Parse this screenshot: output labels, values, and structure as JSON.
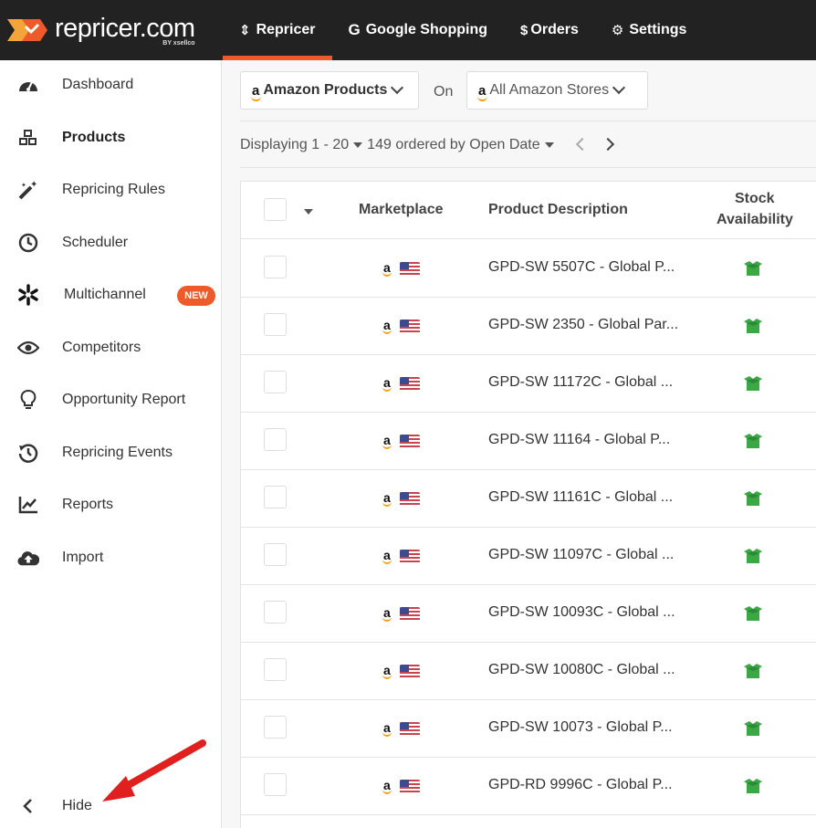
{
  "header": {
    "logo_text": "repricer.com",
    "logo_by": "BY xsellco",
    "nav": [
      {
        "label": "Repricer",
        "icon": "sort-icon",
        "active": true
      },
      {
        "label": "Google Shopping",
        "icon": "google-icon",
        "active": false
      },
      {
        "label": "Orders",
        "icon": "dollar-icon",
        "active": false
      },
      {
        "label": "Settings",
        "icon": "gear-icon",
        "active": false
      }
    ]
  },
  "sidebar": {
    "items": [
      {
        "label": "Dashboard",
        "icon": "dashboard-gauge-icon"
      },
      {
        "label": "Products",
        "icon": "cubes-icon"
      },
      {
        "label": "Repricing Rules",
        "icon": "magic-wand-icon"
      },
      {
        "label": "Scheduler",
        "icon": "clock-icon"
      },
      {
        "label": "Multichannel",
        "icon": "asterisk-icon",
        "badge": "NEW"
      },
      {
        "label": "Competitors",
        "icon": "eye-icon"
      },
      {
        "label": "Opportunity Report",
        "icon": "lightbulb-icon"
      },
      {
        "label": "Repricing Events",
        "icon": "history-icon"
      },
      {
        "label": "Reports",
        "icon": "line-chart-icon"
      },
      {
        "label": "Import",
        "icon": "cloud-upload-icon"
      }
    ],
    "hide_label": "Hide"
  },
  "filters": {
    "products_label": "Amazon Products",
    "on_label": "On",
    "stores_label": "All Amazon Stores"
  },
  "pagination": {
    "range": "Displaying 1 - 20",
    "total_text": "149 ordered by Open Date"
  },
  "table": {
    "headers": {
      "marketplace": "Marketplace",
      "description": "Product Description",
      "stock_line1": "Stock",
      "stock_line2": "Availability"
    },
    "rows": [
      {
        "description": "GPD-SW 5507C - Global P..."
      },
      {
        "description": "GPD-SW 2350 - Global Par..."
      },
      {
        "description": "GPD-SW 11172C - Global ..."
      },
      {
        "description": "GPD-SW 11164 - Global P..."
      },
      {
        "description": "GPD-SW 11161C - Global ..."
      },
      {
        "description": "GPD-SW 11097C - Global ..."
      },
      {
        "description": "GPD-SW 10093C - Global ..."
      },
      {
        "description": "GPD-SW 10080C - Global ..."
      },
      {
        "description": "GPD-SW 10073 - Global P..."
      },
      {
        "description": "GPD-RD 9996C - Global P..."
      }
    ]
  },
  "colors": {
    "topbar": "#222222",
    "accent": "#ef5a2a",
    "stock_green": "#3aa845",
    "annotation_arrow": "#e21f1f"
  }
}
